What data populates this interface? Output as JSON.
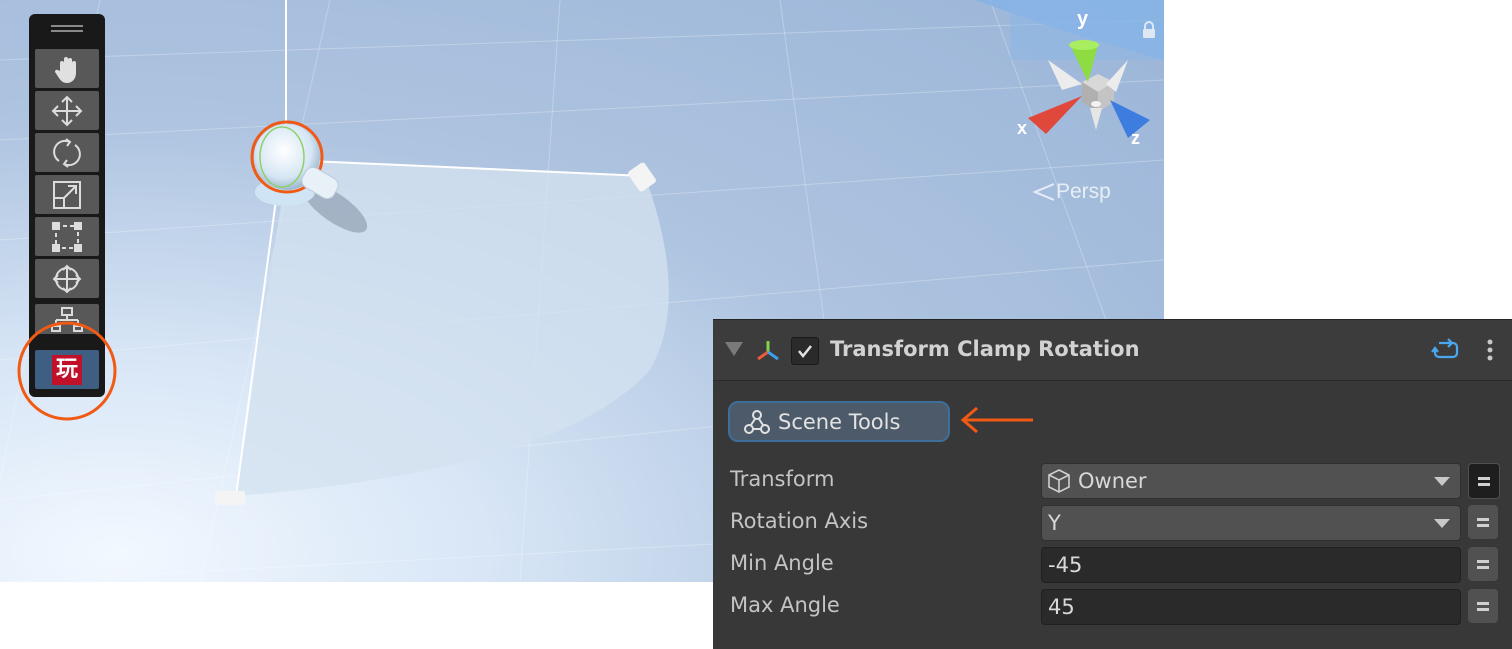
{
  "scene": {
    "gizmo": {
      "axis_y": "y",
      "axis_x": "x",
      "axis_z": "z",
      "projection_label": "Persp",
      "lock_icon": "lock-icon"
    },
    "colors": {
      "x_axis": "#e0483c",
      "y_axis": "#8fdc42",
      "z_axis": "#3e7de0",
      "highlight": "#f05a14"
    }
  },
  "toolbar": {
    "tools": [
      {
        "name": "hand-tool",
        "icon": "hand-icon"
      },
      {
        "name": "move-tool",
        "icon": "move-arrows-icon"
      },
      {
        "name": "rotate-tool",
        "icon": "rotate-icon"
      },
      {
        "name": "scale-tool",
        "icon": "scale-icon"
      },
      {
        "name": "rect-tool",
        "icon": "rect-transform-icon"
      },
      {
        "name": "transform-tool",
        "icon": "transform-icon"
      },
      {
        "name": "component-tools-toggle",
        "icon": "component-tools-icon"
      },
      {
        "name": "custom-tool",
        "icon": "custom-tool-icon",
        "glyph": "玩"
      }
    ]
  },
  "inspector": {
    "component_title": "Transform Clamp Rotation",
    "enabled": true,
    "scene_tools_button": "Scene Tools",
    "properties": [
      {
        "label": "Transform",
        "value": "Owner",
        "type": "object-field"
      },
      {
        "label": "Rotation Axis",
        "value": "Y",
        "type": "dropdown"
      },
      {
        "label": "Min Angle",
        "value": "-45",
        "type": "number"
      },
      {
        "label": "Max Angle",
        "value": "45",
        "type": "number"
      }
    ]
  }
}
